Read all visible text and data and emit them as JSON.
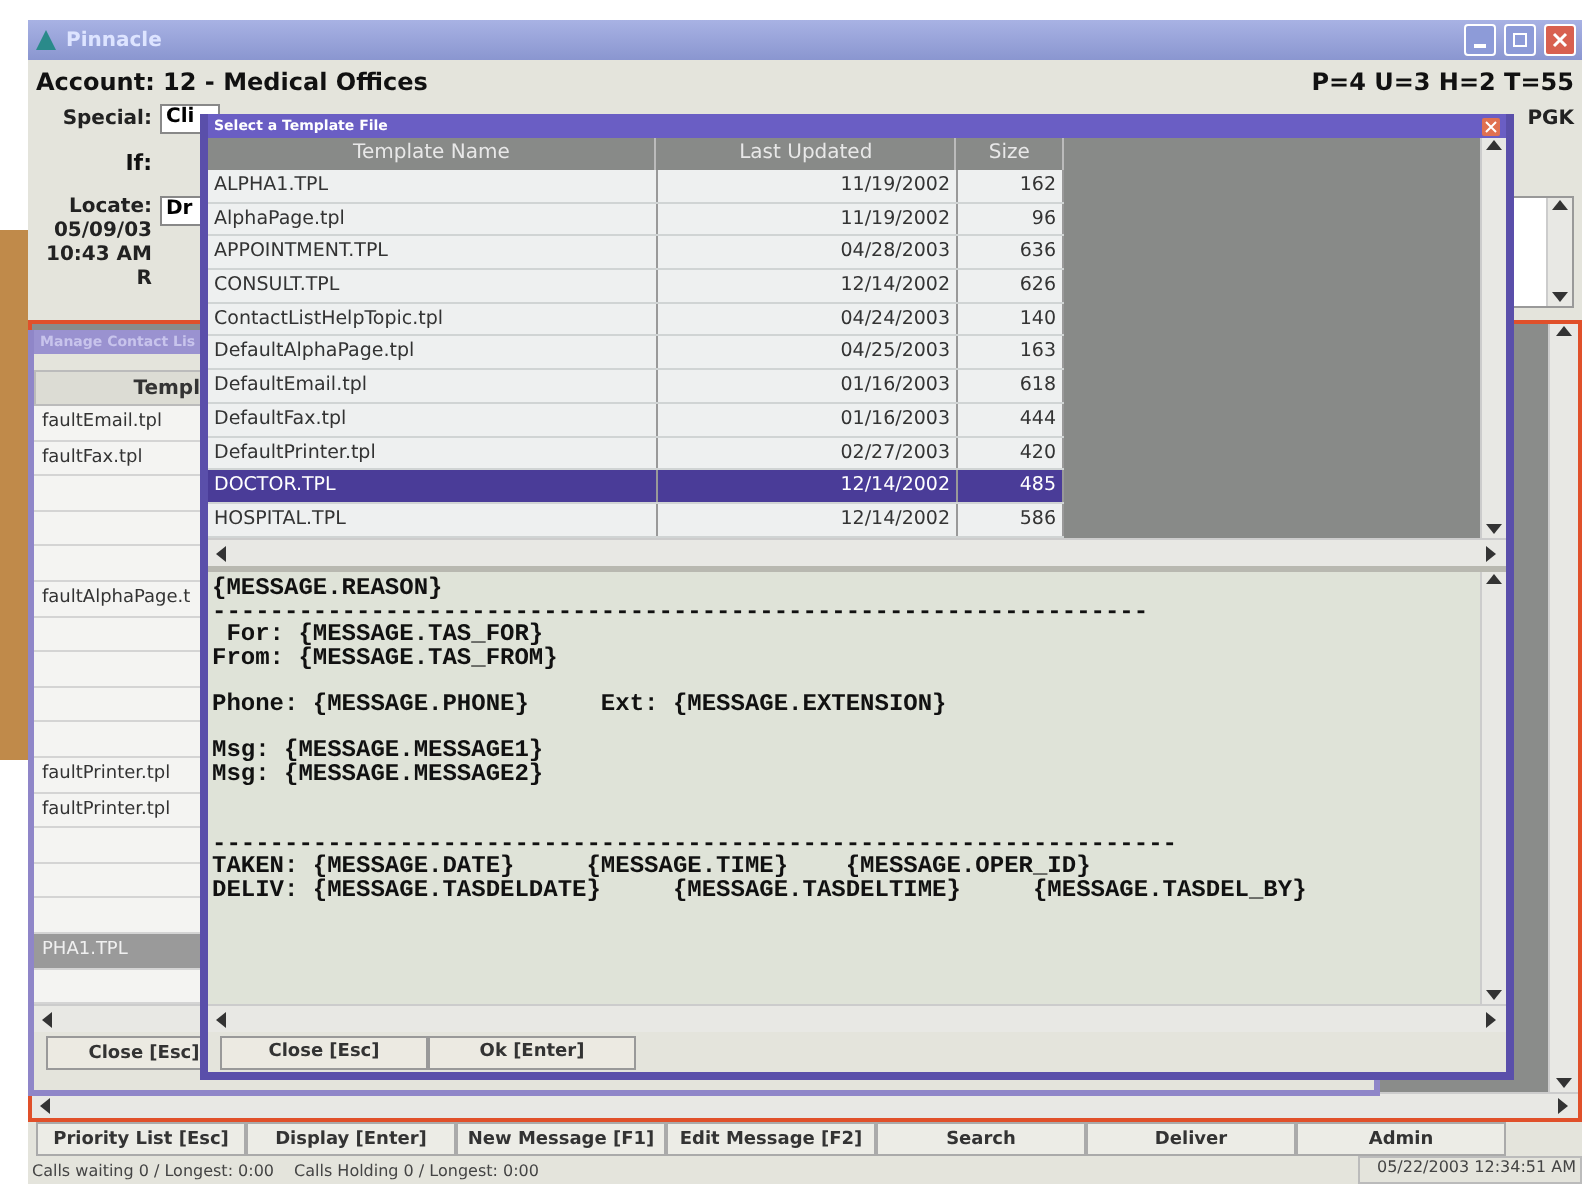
{
  "main_window": {
    "title": "Pinnacle",
    "account": "Account: 12 - Medical Offices",
    "counts": "P=4 U=3 H=2 T=55",
    "special_label": "Special:",
    "special_value": "Cli",
    "special_right": "PGK",
    "if_label": "If:",
    "locate_label": "Locate:",
    "locate_value": "Dr",
    "date": "05/09/03",
    "time": "10:43 AM",
    "flag": "R"
  },
  "contact_window": {
    "title": "Manage Contact Lis",
    "column": "Templ",
    "rows": [
      {
        "name": "faultEmail.tpl",
        "selected": false
      },
      {
        "name": "faultFax.tpl",
        "selected": false
      },
      {
        "selected": false
      },
      {
        "selected": false
      },
      {
        "selected": false
      },
      {
        "name": "faultAlphaPage.t",
        "selected": false
      },
      {
        "selected": false
      },
      {
        "selected": false
      },
      {
        "selected": false
      },
      {
        "selected": false
      },
      {
        "name": "faultPrinter.tpl",
        "selected": false
      },
      {
        "name": "faultPrinter.tpl",
        "selected": false
      },
      {
        "selected": false
      },
      {
        "selected": false
      },
      {
        "selected": false
      },
      {
        "name": "PHA1.TPL",
        "selected": true
      },
      {
        "selected": false
      }
    ],
    "buttons": [
      "Close [Esc]"
    ]
  },
  "template_dialog": {
    "title": "Select a Template File",
    "columns": [
      "Template Name",
      "Last Updated",
      "Size"
    ],
    "rows": [
      {
        "name": "ALPHA1.TPL",
        "updated": "11/19/2002",
        "size": "162",
        "selected": false
      },
      {
        "name": "AlphaPage.tpl",
        "updated": "11/19/2002",
        "size": "96",
        "selected": false
      },
      {
        "name": "APPOINTMENT.TPL",
        "updated": "04/28/2003",
        "size": "636",
        "selected": false
      },
      {
        "name": "CONSULT.TPL",
        "updated": "12/14/2002",
        "size": "626",
        "selected": false
      },
      {
        "name": "ContactListHelpTopic.tpl",
        "updated": "04/24/2003",
        "size": "140",
        "selected": false
      },
      {
        "name": "DefaultAlphaPage.tpl",
        "updated": "04/25/2003",
        "size": "163",
        "selected": false
      },
      {
        "name": "DefaultEmail.tpl",
        "updated": "01/16/2003",
        "size": "618",
        "selected": false
      },
      {
        "name": "DefaultFax.tpl",
        "updated": "01/16/2003",
        "size": "444",
        "selected": false
      },
      {
        "name": "DefaultPrinter.tpl",
        "updated": "02/27/2003",
        "size": "420",
        "selected": false
      },
      {
        "name": "DOCTOR.TPL",
        "updated": "12/14/2002",
        "size": "485",
        "selected": true
      },
      {
        "name": "HOSPITAL.TPL",
        "updated": "12/14/2002",
        "size": "586",
        "selected": false
      }
    ],
    "preview": "{MESSAGE.REASON}\n-----------------------------------------------------------------\n For: {MESSAGE.TAS_FOR}\nFrom: {MESSAGE.TAS_FROM}\n\nPhone: {MESSAGE.PHONE}     Ext: {MESSAGE.EXTENSION}\n\nMsg: {MESSAGE.MESSAGE1}\nMsg: {MESSAGE.MESSAGE2}\n\n\n-------------------------------------------------------------------\nTAKEN: {MESSAGE.DATE}     {MESSAGE.TIME}    {MESSAGE.OPER_ID}\nDELIV: {MESSAGE.TASDELDATE}     {MESSAGE.TASDELTIME}     {MESSAGE.TASDEL_BY}",
    "buttons": [
      "Close [Esc]",
      "Ok [Enter]"
    ]
  },
  "command_buttons": [
    "Priority List [Esc]",
    "Display [Enter]",
    "New Message [F1]",
    "Edit Message [F2]",
    "Search",
    "Deliver",
    "Admin"
  ],
  "status_bar": {
    "calls_waiting": "Calls waiting 0 / Longest: 0:00",
    "calls_holding": "Calls Holding 0 / Longest: 0:00",
    "datetime": "05/22/2003 12:34:51 AM"
  }
}
